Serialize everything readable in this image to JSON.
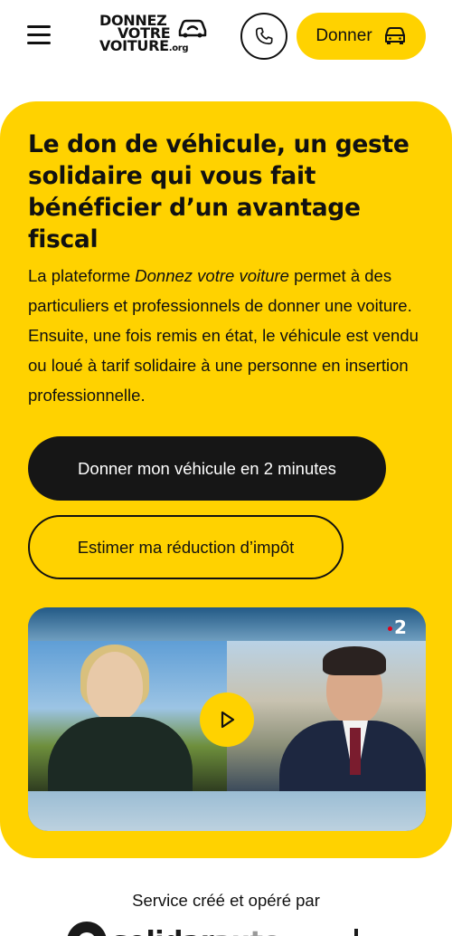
{
  "header": {
    "logo": {
      "line1": "DONNEZ",
      "line2": "VOTRE",
      "line3": "VOITURE",
      "suffix": ".org"
    },
    "phone_icon": "phone-icon",
    "donate_label": "Donner",
    "donate_icon": "car-icon"
  },
  "hero": {
    "title": "Le don de véhicule, un geste solidaire qui vous fait bénéficier d’un avantage fiscal",
    "description": {
      "before": "La plateforme ",
      "emphasis": "Donnez votre voiture",
      "after": " permet à des particuliers et professionnels de donner une voiture. Ensuite, une fois remis en état, le véhicule est vendu ou loué à tarif solidaire à une personne en insertion professionnelle."
    },
    "primary_cta": "Donner mon véhicule en 2 minutes",
    "secondary_cta": "Estimer ma réduction d’impôt",
    "video": {
      "channel_dot": "•",
      "channel_number": "2",
      "play_icon": "play-icon"
    }
  },
  "footer": {
    "operated_by": "Service créé et opéré par",
    "partner_name_main": "solidar",
    "partner_name_accent": "auto"
  },
  "colors": {
    "brand_yellow": "#FFD200",
    "dark": "#161616",
    "background": "#ffffff"
  }
}
